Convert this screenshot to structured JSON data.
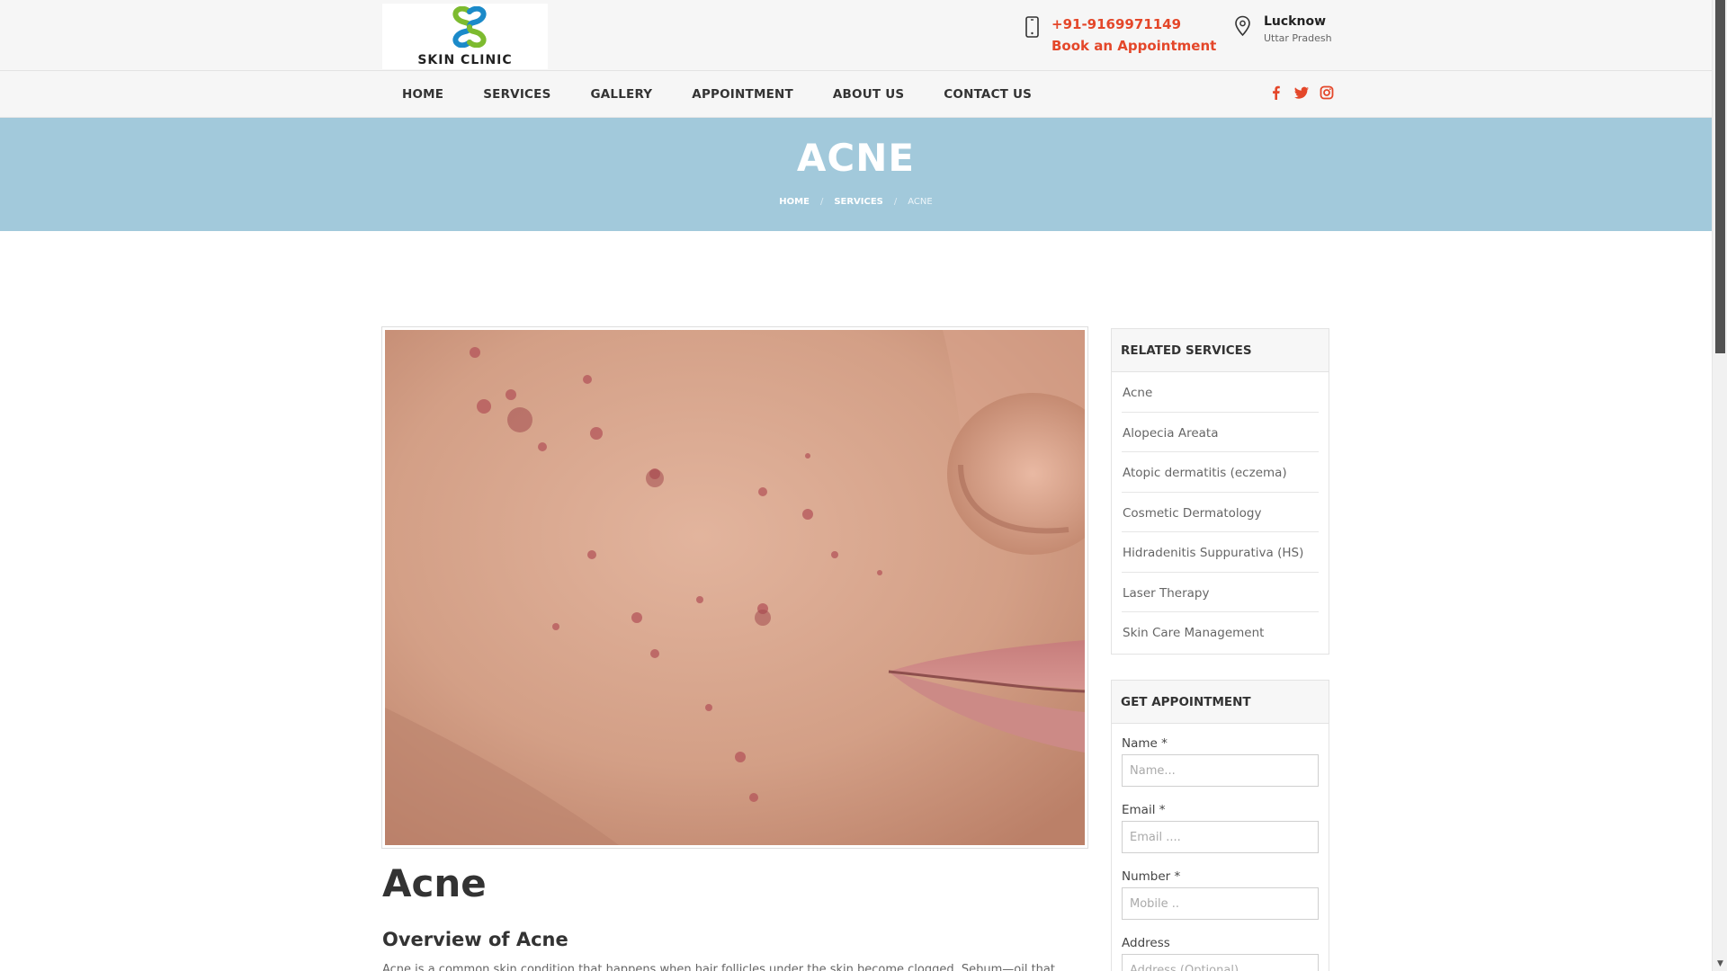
{
  "brand": {
    "name": "SKIN CLINIC"
  },
  "header": {
    "phone": "+91-9169971149",
    "book_label": "Book an Appointment",
    "city": "Lucknow",
    "state": "Uttar Pradesh"
  },
  "nav": {
    "items": [
      "HOME",
      "SERVICES",
      "GALLERY",
      "APPOINTMENT",
      "ABOUT US",
      "CONTACT US"
    ],
    "social_icons": [
      "facebook-icon",
      "twitter-icon",
      "instagram-icon"
    ]
  },
  "banner": {
    "title": "ACNE",
    "breadcrumb": [
      "HOME",
      "SERVICES",
      "ACNE"
    ],
    "separator": "/"
  },
  "article": {
    "title": "Acne",
    "subtitle": "Overview of Acne",
    "paragraph": "Acne is a common skin condition that happens when hair follicles under the skin become clogged. Sebum—oil that"
  },
  "related": {
    "heading": "RELATED SERVICES",
    "items": [
      "Acne",
      "Alopecia Areata",
      "Atopic dermatitis (eczema)",
      "Cosmetic Dermatology",
      "Hidradenitis Suppurativa (HS)",
      "Laser Therapy",
      "Skin Care Management"
    ]
  },
  "appointment": {
    "heading": "GET APPOINTMENT",
    "fields": [
      {
        "label": "Name *",
        "placeholder": "Name..."
      },
      {
        "label": "Email *",
        "placeholder": "Email ...."
      },
      {
        "label": "Number *",
        "placeholder": "Mobile .."
      },
      {
        "label": "Address",
        "placeholder": "Address (Optional)..."
      }
    ]
  },
  "colors": {
    "accent": "#e4472a",
    "banner": "#a2c9db",
    "logo_blue": "#1b8ac9",
    "logo_green": "#7dbb2f"
  }
}
